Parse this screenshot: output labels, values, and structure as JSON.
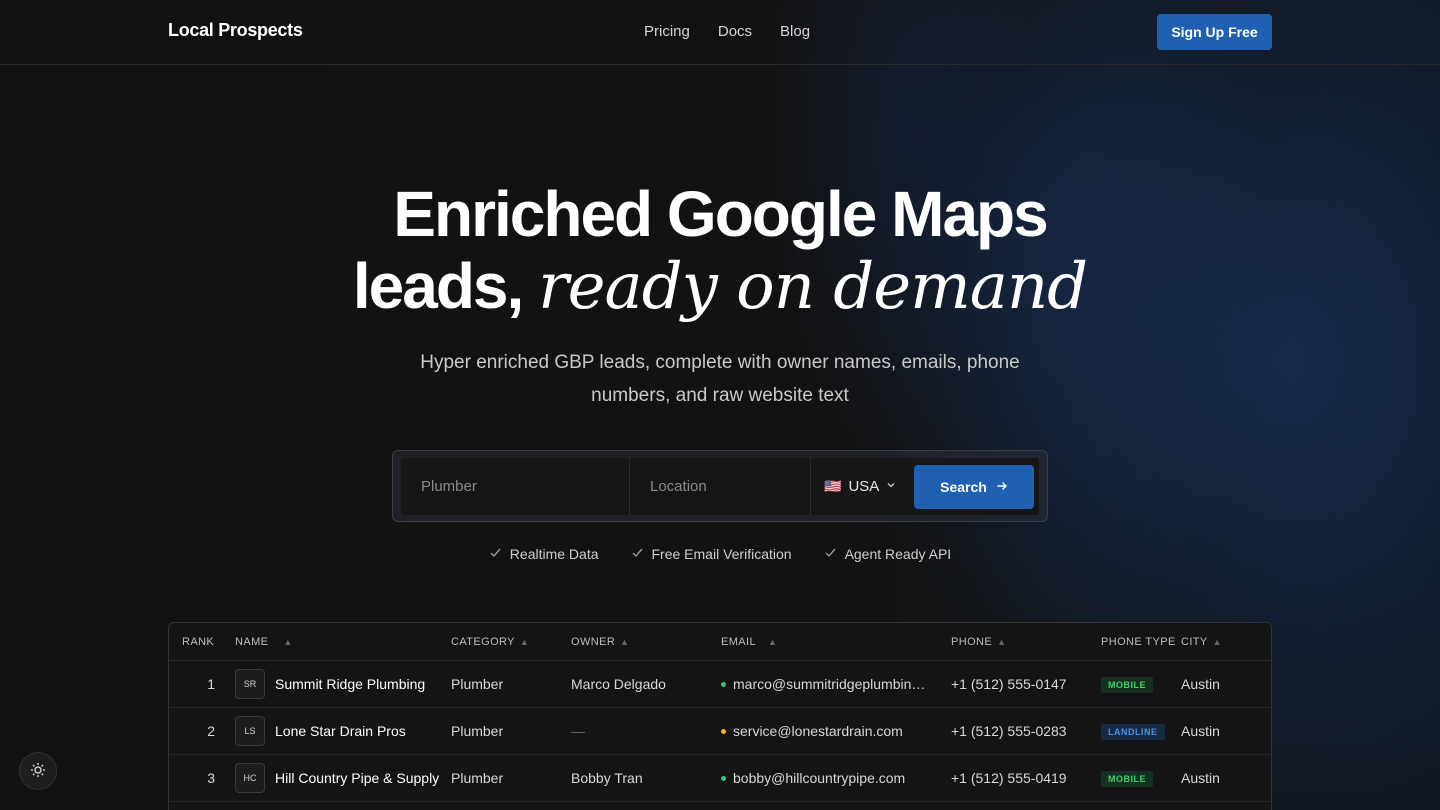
{
  "brand": {
    "name": "Local Prospects"
  },
  "nav": {
    "items": [
      "Pricing",
      "Docs",
      "Blog"
    ],
    "signup_label": "Sign Up Free"
  },
  "hero": {
    "title_line1": "Enriched Google Maps",
    "title_line2_plain": "leads,",
    "title_line2_italic": "ready on demand",
    "subtitle": "Hyper enriched GBP leads, complete with owner names, emails, phone numbers, and raw website text"
  },
  "search": {
    "keyword_placeholder": "Plumber",
    "location_placeholder": "Location",
    "country": "USA",
    "button_label": "Search"
  },
  "features": [
    "Realtime Data",
    "Free Email Verification",
    "Agent Ready API"
  ],
  "table": {
    "columns": [
      "RANK",
      "NAME",
      "CATEGORY",
      "OWNER",
      "EMAIL",
      "PHONE",
      "PHONE TYPE",
      "CITY"
    ],
    "rows": [
      {
        "rank": "1",
        "initials": "SR",
        "name": "Summit Ridge Plumbing",
        "category": "Plumber",
        "owner": "Marco Delgado",
        "email": "marco@summitridgeplumbing.com",
        "email_status_color": "#2ecc71",
        "phone": "+1 (512) 555-0147",
        "phone_type": "MOBILE",
        "city": "Austin"
      },
      {
        "rank": "2",
        "initials": "LS",
        "name": "Lone Star Drain Pros",
        "category": "Plumber",
        "owner": "—",
        "email": "service@lonestardrain.com",
        "email_status_color": "#f0b429",
        "phone": "+1 (512) 555-0283",
        "phone_type": "LANDLINE",
        "city": "Austin"
      },
      {
        "rank": "3",
        "initials": "HC",
        "name": "Hill Country Pipe & Supply",
        "category": "Plumber",
        "owner": "Bobby Tran",
        "email": "bobby@hillcountrypipe.com",
        "email_status_color": "#2ecc71",
        "phone": "+1 (512) 555-0419",
        "phone_type": "MOBILE",
        "city": "Austin"
      }
    ]
  },
  "colors": {
    "accent": "#2060b0",
    "mobile_badge_bg": "#15301f",
    "mobile_badge_fg": "#3ecf6e",
    "landline_badge_bg": "#142a45",
    "landline_badge_fg": "#4f8fdc"
  },
  "icons": {
    "theme": "sun-icon",
    "search_arrow": "arrow-right-icon",
    "check": "check-icon",
    "sort": "sort-caret-icon"
  }
}
